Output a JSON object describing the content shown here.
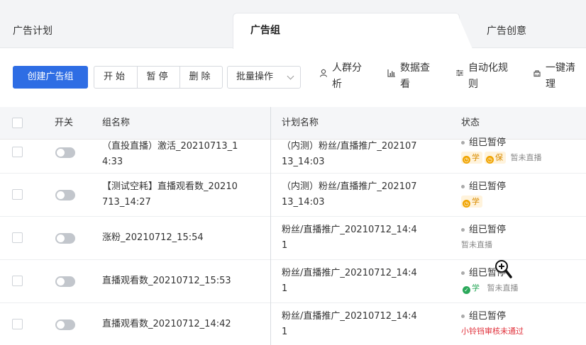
{
  "tabs": [
    "广告计划",
    "广告组",
    "广告创意"
  ],
  "toolbar": {
    "create_label": "创建广告组",
    "start_label": "开始",
    "pause_label": "暂停",
    "delete_label": "删除",
    "batch_label": "批量操作",
    "audience_label": [
      "人群分",
      "析"
    ],
    "data_label": [
      "数据查",
      "看"
    ],
    "auto_rules_label": [
      "自动化规",
      "则"
    ],
    "cleanup_label": [
      "一键清",
      "理"
    ]
  },
  "table": {
    "headers": {
      "switch": "开关",
      "group_name": "组名称",
      "plan_name": "计划名称",
      "status": "状态"
    },
    "rows": [
      {
        "name": [
          "（直投直播）激活_20210713_1",
          "4:33"
        ],
        "plan": [
          "（内测）粉丝/直播推广_202107",
          "13_14:03"
        ],
        "status": "组已暂停",
        "tags": [
          "学",
          "保"
        ],
        "note": "暂未直播",
        "note_type": "muted"
      },
      {
        "name": [
          "【测试空耗】直播观看数_20210",
          "713_14:27"
        ],
        "plan": [
          "（内测）粉丝/直播推广_202107",
          "13_14:03"
        ],
        "status": "组已暂停",
        "tags": [
          "学"
        ],
        "note": "",
        "note_type": "muted"
      },
      {
        "name": [
          "涨粉_20210712_15:54"
        ],
        "plan": [
          "粉丝/直播推广_20210712_14:4",
          "1"
        ],
        "status": "组已暂停",
        "tags": [],
        "note": "暂未直播",
        "note_type": "muted"
      },
      {
        "name": [
          "直播观看数_20210712_15:53"
        ],
        "plan": [
          "粉丝/直播推广_20210712_14:4",
          "1"
        ],
        "status": "组已暂停",
        "tags": [
          "学"
        ],
        "note": "暂未直播",
        "note_type": "muted"
      },
      {
        "name": [
          "直播观看数_20210712_14:42"
        ],
        "plan": [
          "粉丝/直播推广_20210712_14:4",
          "1"
        ],
        "status": "组已暂停",
        "tags": [],
        "note": "小铃铛审核未通过",
        "note_type": "red"
      }
    ]
  },
  "colors": {
    "primary": "#2e6de4",
    "tag_yellow": "#f0a400",
    "tag_green": "#2aa85a",
    "error_red": "#e0303a"
  }
}
